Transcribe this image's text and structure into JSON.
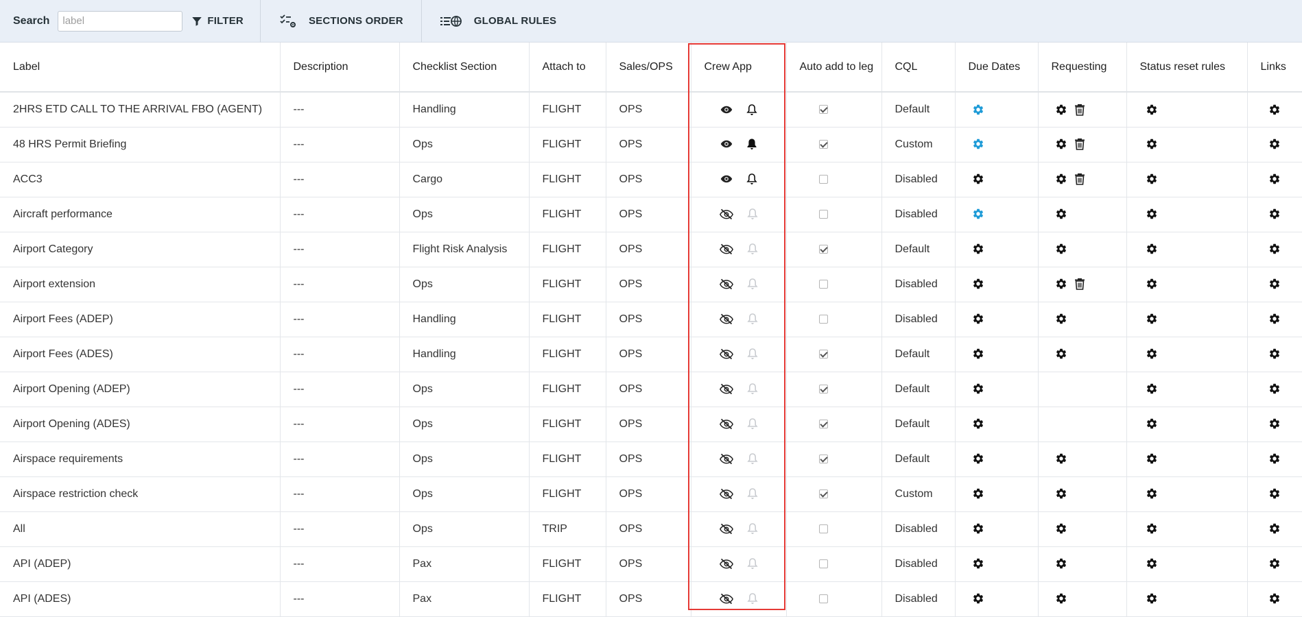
{
  "toolbar": {
    "search_label": "Search",
    "search_placeholder": "label",
    "filter_label": "FILTER",
    "sections_order_label": "SECTIONS ORDER",
    "global_rules_label": "GLOBAL RULES"
  },
  "colors": {
    "accent_gear": "#1e9bd7",
    "highlight": "#e53935",
    "toolbar_bg": "#e9eff7"
  },
  "columns": [
    "Label",
    "Description",
    "Checklist Section",
    "Attach to",
    "Sales/OPS",
    "Crew App",
    "Auto add to leg",
    "CQL",
    "Due Dates",
    "Requesting",
    "Status reset rules",
    "Links"
  ],
  "rows": [
    {
      "label": "2HRS ETD CALL TO THE ARRIVAL FBO (AGENT)",
      "description": "---",
      "section": "Handling",
      "attach": "FLIGHT",
      "salesops": "OPS",
      "crew_visible": true,
      "bell": "outline",
      "auto": true,
      "cql": "Default",
      "due_blue": true,
      "req": true,
      "req_trash": true
    },
    {
      "label": "48 HRS Permit Briefing",
      "description": "---",
      "section": "Ops",
      "attach": "FLIGHT",
      "salesops": "OPS",
      "crew_visible": true,
      "bell": "filled",
      "auto": true,
      "cql": "Custom",
      "due_blue": true,
      "req": true,
      "req_trash": true
    },
    {
      "label": "ACC3",
      "description": "---",
      "section": "Cargo",
      "attach": "FLIGHT",
      "salesops": "OPS",
      "crew_visible": true,
      "bell": "outline",
      "auto": false,
      "cql": "Disabled",
      "due_blue": false,
      "req": true,
      "req_trash": true
    },
    {
      "label": "Aircraft performance",
      "description": "---",
      "section": "Ops",
      "attach": "FLIGHT",
      "salesops": "OPS",
      "crew_visible": false,
      "bell": "disabled",
      "auto": false,
      "cql": "Disabled",
      "due_blue": true,
      "req": true,
      "req_trash": false
    },
    {
      "label": "Airport Category",
      "description": "---",
      "section": "Flight Risk Analysis",
      "attach": "FLIGHT",
      "salesops": "OPS",
      "crew_visible": false,
      "bell": "disabled",
      "auto": true,
      "cql": "Default",
      "due_blue": false,
      "req": true,
      "req_trash": false
    },
    {
      "label": "Airport extension",
      "description": "---",
      "section": "Ops",
      "attach": "FLIGHT",
      "salesops": "OPS",
      "crew_visible": false,
      "bell": "disabled",
      "auto": false,
      "cql": "Disabled",
      "due_blue": false,
      "req": true,
      "req_trash": true
    },
    {
      "label": "Airport Fees (ADEP)",
      "description": "---",
      "section": "Handling",
      "attach": "FLIGHT",
      "salesops": "OPS",
      "crew_visible": false,
      "bell": "disabled",
      "auto": false,
      "cql": "Disabled",
      "due_blue": false,
      "req": true,
      "req_trash": false
    },
    {
      "label": "Airport Fees (ADES)",
      "description": "---",
      "section": "Handling",
      "attach": "FLIGHT",
      "salesops": "OPS",
      "crew_visible": false,
      "bell": "disabled",
      "auto": true,
      "cql": "Default",
      "due_blue": false,
      "req": true,
      "req_trash": false
    },
    {
      "label": "Airport Opening (ADEP)",
      "description": "---",
      "section": "Ops",
      "attach": "FLIGHT",
      "salesops": "OPS",
      "crew_visible": false,
      "bell": "disabled",
      "auto": true,
      "cql": "Default",
      "due_blue": false,
      "req": false,
      "req_trash": false
    },
    {
      "label": "Airport Opening (ADES)",
      "description": "---",
      "section": "Ops",
      "attach": "FLIGHT",
      "salesops": "OPS",
      "crew_visible": false,
      "bell": "disabled",
      "auto": true,
      "cql": "Default",
      "due_blue": false,
      "req": false,
      "req_trash": false
    },
    {
      "label": "Airspace requirements",
      "description": "---",
      "section": "Ops",
      "attach": "FLIGHT",
      "salesops": "OPS",
      "crew_visible": false,
      "bell": "disabled",
      "auto": true,
      "cql": "Default",
      "due_blue": false,
      "req": true,
      "req_trash": false
    },
    {
      "label": "Airspace restriction check",
      "description": "---",
      "section": "Ops",
      "attach": "FLIGHT",
      "salesops": "OPS",
      "crew_visible": false,
      "bell": "disabled",
      "auto": true,
      "cql": "Custom",
      "due_blue": false,
      "req": true,
      "req_trash": false
    },
    {
      "label": "All",
      "description": "---",
      "section": "Ops",
      "attach": "TRIP",
      "salesops": "OPS",
      "crew_visible": false,
      "bell": "disabled",
      "auto": false,
      "cql": "Disabled",
      "due_blue": false,
      "req": true,
      "req_trash": false
    },
    {
      "label": "API (ADEP)",
      "description": "---",
      "section": "Pax",
      "attach": "FLIGHT",
      "salesops": "OPS",
      "crew_visible": false,
      "bell": "disabled",
      "auto": false,
      "cql": "Disabled",
      "due_blue": false,
      "req": true,
      "req_trash": false
    },
    {
      "label": "API (ADES)",
      "description": "---",
      "section": "Pax",
      "attach": "FLIGHT",
      "salesops": "OPS",
      "crew_visible": false,
      "bell": "disabled",
      "auto": false,
      "cql": "Disabled",
      "due_blue": false,
      "req": true,
      "req_trash": false
    }
  ]
}
